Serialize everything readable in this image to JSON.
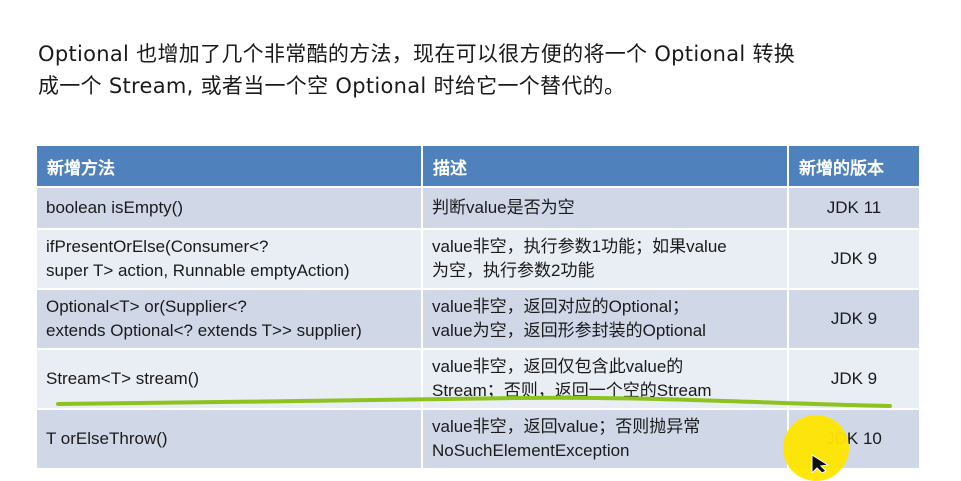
{
  "intro": {
    "line1": "Optional 也增加了几个非常酷的方法，现在可以很方便的将一个 Optional 转换",
    "line2": "成一个 Stream, 或者当一个空 Optional 时给它一个替代的。"
  },
  "table": {
    "headers": [
      "新增方法",
      "描述",
      "新增的版本"
    ],
    "rows": [
      {
        "method": [
          "boolean isEmpty()"
        ],
        "desc": [
          "判断value是否为空"
        ],
        "version": "JDK 11"
      },
      {
        "method": [
          "ifPresentOrElse(Consumer<?",
          "super T> action, Runnable emptyAction)"
        ],
        "desc": [
          "value非空，执行参数1功能；如果value",
          "为空，执行参数2功能"
        ],
        "version": "JDK 9"
      },
      {
        "method": [
          "Optional<T> or(Supplier<?",
          "extends Optional<? extends T>> supplier)"
        ],
        "desc": [
          "value非空，返回对应的Optional；",
          "value为空，返回形参封装的Optional"
        ],
        "version": "JDK 9"
      },
      {
        "method": [
          "Stream<T> stream()"
        ],
        "desc": [
          "value非空，返回仅包含此value的",
          "Stream；否则，返回一个空的Stream"
        ],
        "version": "JDK 9"
      },
      {
        "method": [
          "T orElseThrow()"
        ],
        "desc": [
          "value非空，返回value；否则抛异常",
          "NoSuchElementException"
        ],
        "version": "JDK 10"
      }
    ]
  },
  "colors": {
    "header_bg": "#4f81bd",
    "row_odd": "#d0d8e8",
    "row_even": "#e9edf4",
    "highlight_line": "#8dc21f",
    "cursor_highlight": "#ffe600"
  }
}
